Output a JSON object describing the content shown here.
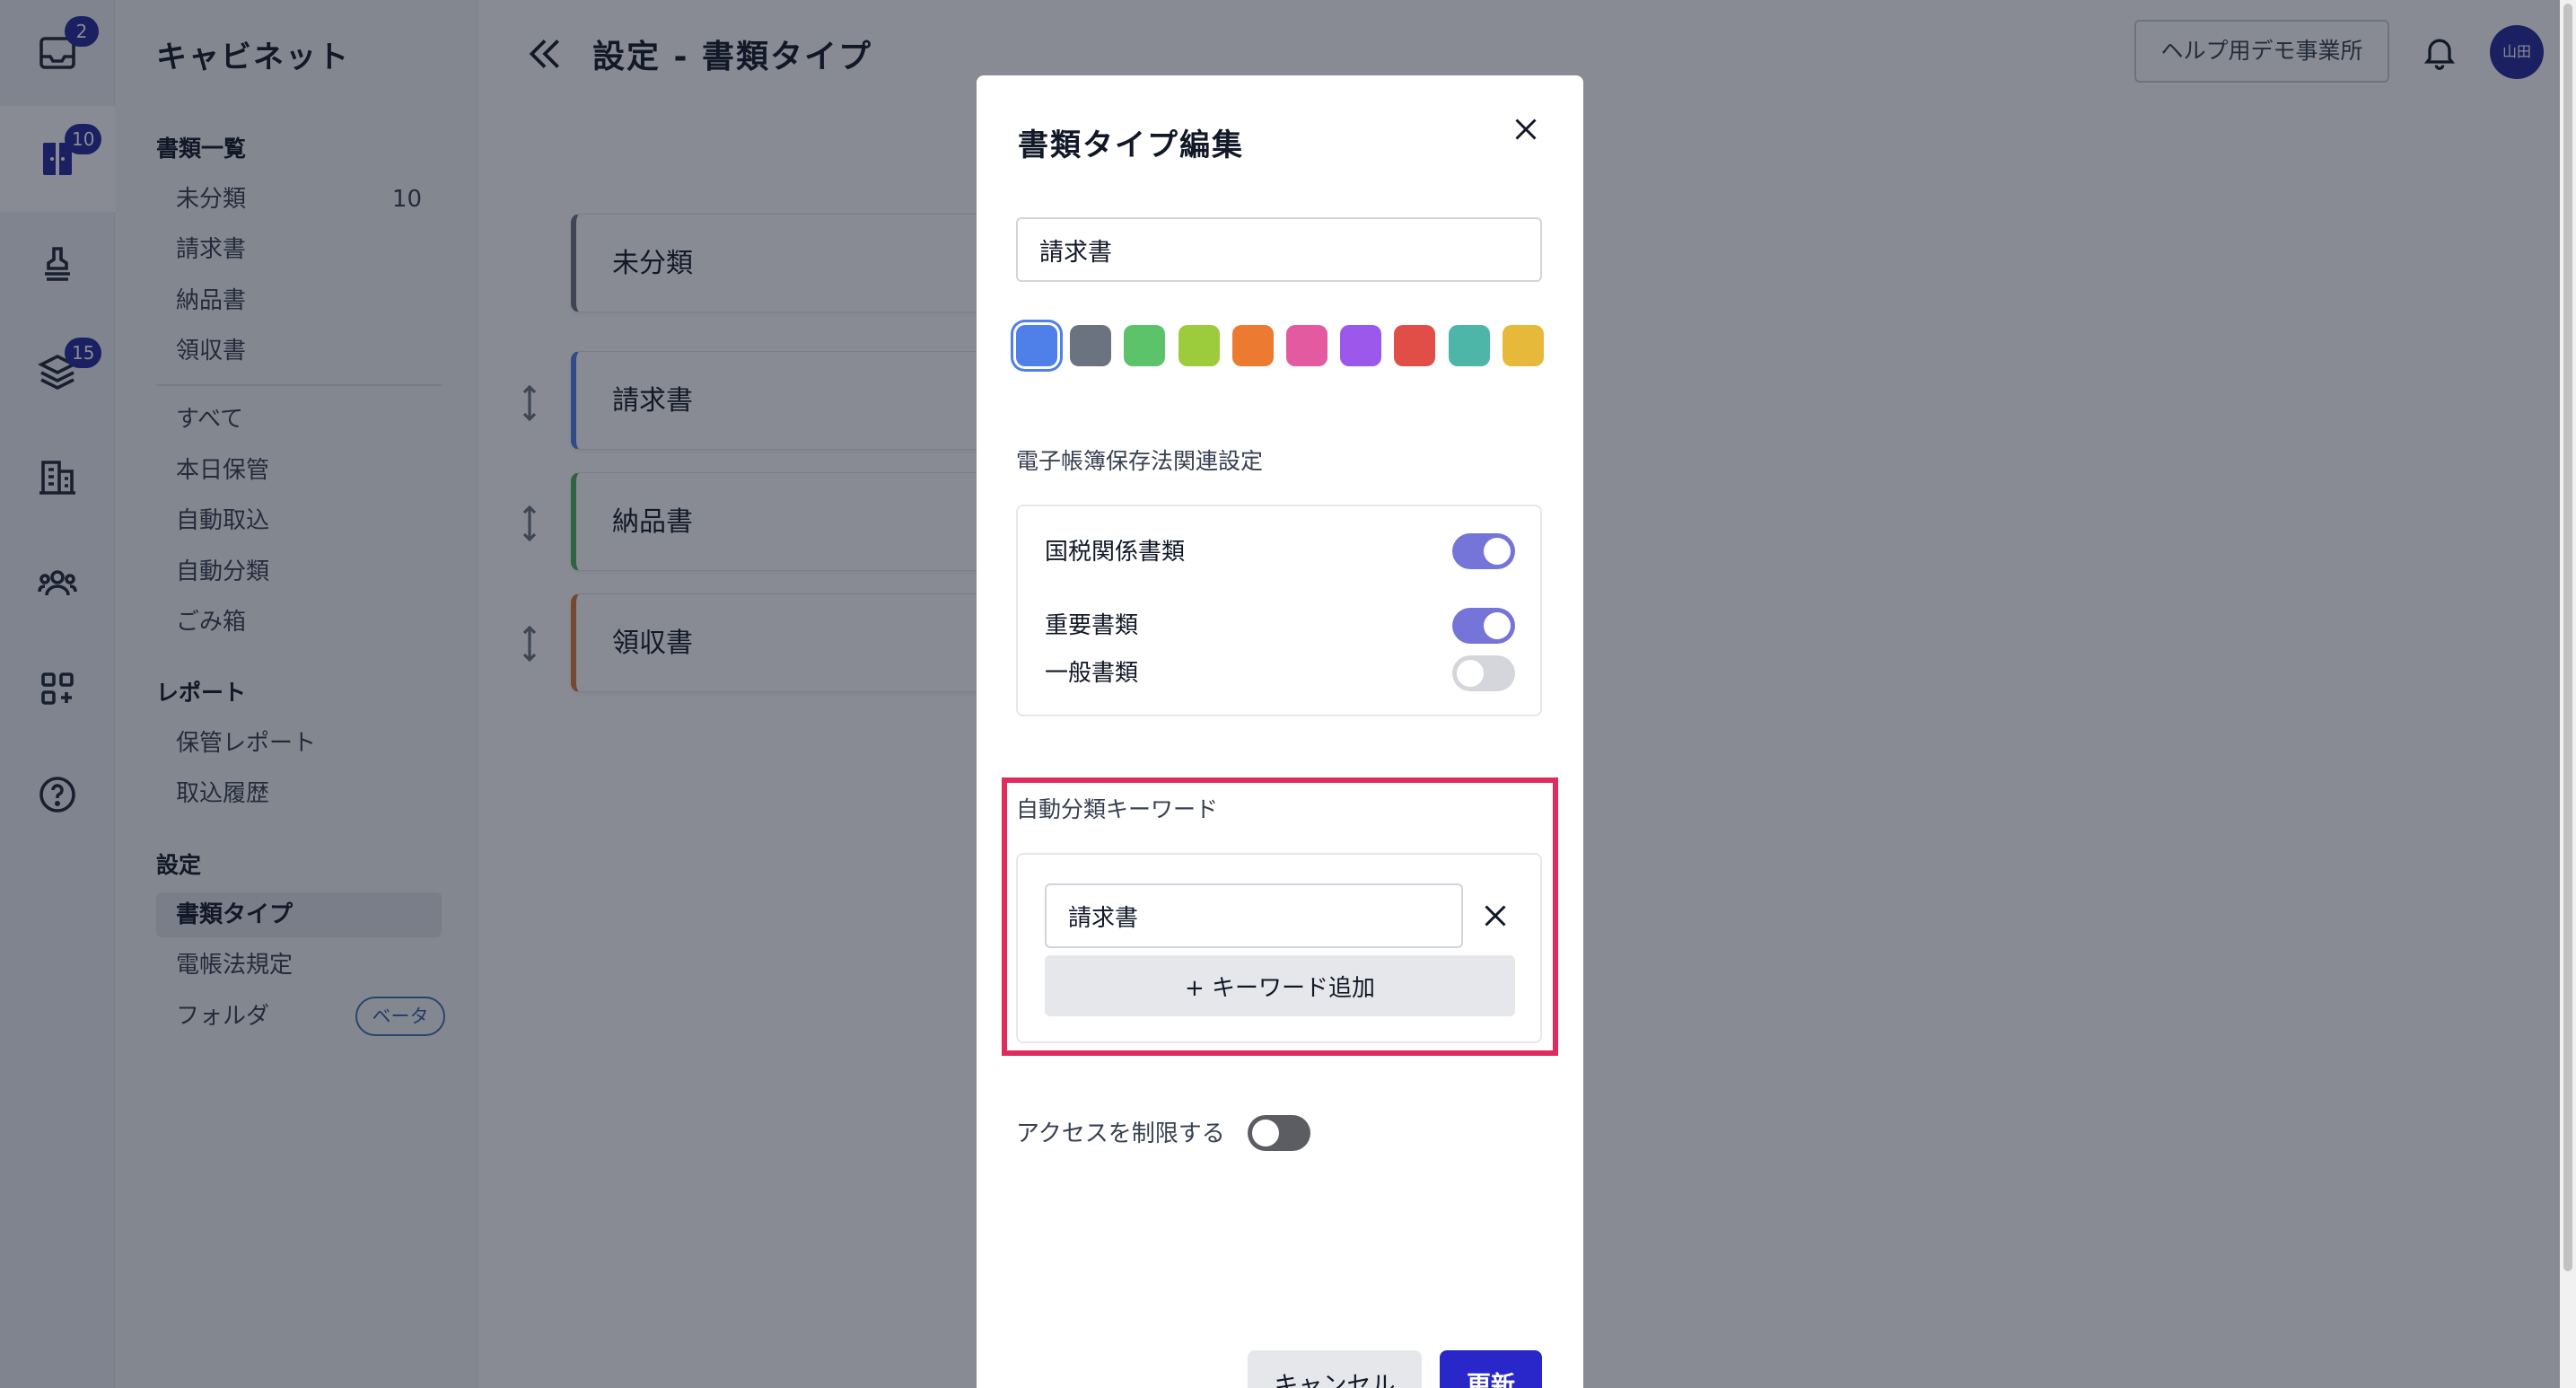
{
  "rail": {
    "items": [
      {
        "name": "inbox-icon",
        "badge": "2"
      },
      {
        "name": "cabinet-icon",
        "badge": "10"
      },
      {
        "name": "stamp-icon",
        "badge": ""
      },
      {
        "name": "layers-icon",
        "badge": "15"
      },
      {
        "name": "building-icon",
        "badge": ""
      },
      {
        "name": "users-icon",
        "badge": ""
      },
      {
        "name": "apps-add-icon",
        "badge": ""
      },
      {
        "name": "help-icon",
        "badge": ""
      }
    ]
  },
  "sidebar": {
    "app_title": "キャビネット",
    "documents_section": "書類一覧",
    "doc_items": [
      {
        "label": "未分類",
        "count": "10"
      },
      {
        "label": "請求書"
      },
      {
        "label": "納品書"
      },
      {
        "label": "領収書"
      }
    ],
    "filter_items": [
      "すべて",
      "本日保管",
      "自動取込",
      "自動分類",
      "ごみ箱"
    ],
    "report_section": "レポート",
    "report_items": [
      "保管レポート",
      "取込履歴"
    ],
    "settings_section": "設定",
    "settings_items": [
      "書類タイプ",
      "電帳法規定",
      "フォルダ"
    ],
    "beta_label": "ベータ"
  },
  "header": {
    "title": "設定 - 書類タイプ",
    "office_name": "ヘルプ用デモ事業所",
    "avatar_text": "山田"
  },
  "cards": [
    {
      "label": "未分類",
      "color": "#6b7280"
    },
    {
      "label": "請求書",
      "color": "#4f7fe8"
    },
    {
      "label": "納品書",
      "color": "#4fae5a"
    },
    {
      "label": "領収書",
      "color": "#d9783a"
    }
  ],
  "modal": {
    "title": "書類タイプ編集",
    "name_value": "請求書",
    "swatch_colors": [
      "#4f7fe8",
      "#6b7280",
      "#5cc36b",
      "#9ccb3c",
      "#ec7a31",
      "#e35aa0",
      "#9b58ea",
      "#e14d47",
      "#4eb6a9",
      "#e7b93a"
    ],
    "selected_color": "#4f7fe8",
    "ebook_section": "電子帳簿保存法関連設定",
    "tax_docs_label": "国税関係書類",
    "important_docs_label": "重要書類",
    "general_docs_label": "一般書類",
    "tax_docs_on": true,
    "important_docs_on": true,
    "general_docs_on": false,
    "keyword_section": "自動分類キーワード",
    "keywords": [
      "請求書"
    ],
    "add_keyword_label": "+ キーワード追加",
    "restrict_access_label": "アクセスを制限する",
    "restrict_access_on": false,
    "cancel_label": "キャンセル",
    "update_label": "更新"
  }
}
